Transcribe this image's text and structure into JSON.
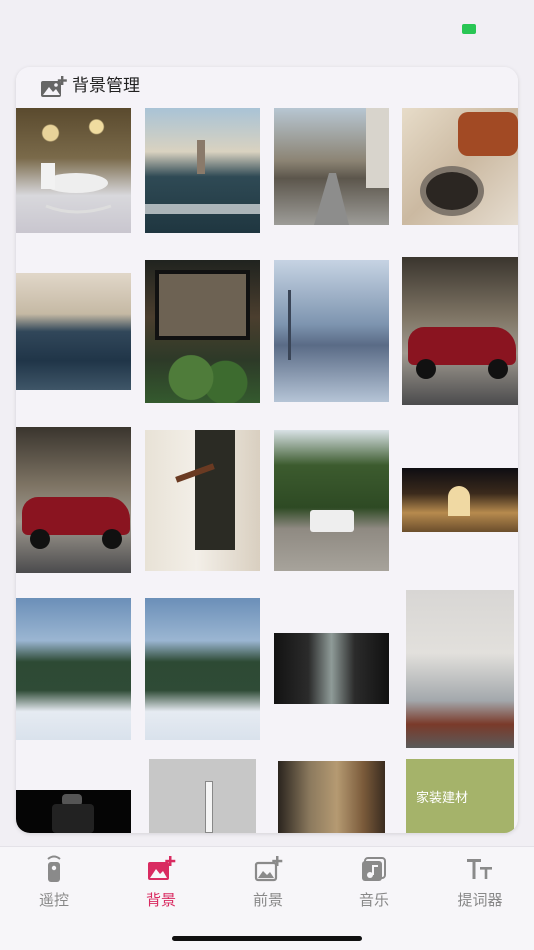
{
  "colors": {
    "accent": "#d92b61",
    "inactive": "#8a8a8a",
    "battery": "#29c654",
    "background": "#f1eff4"
  },
  "header": {
    "icon": "image-plus-icon",
    "title": "背景管理"
  },
  "gallery": {
    "images": [
      {
        "name": "rocking-horse-photo",
        "caption": ""
      },
      {
        "name": "lighthouse-sea-photo",
        "caption": ""
      },
      {
        "name": "tree-lined-street-photo",
        "caption": ""
      },
      {
        "name": "food-bowl-photo",
        "caption": ""
      },
      {
        "name": "city-waterfront-photo",
        "caption": ""
      },
      {
        "name": "cafe-window-plants-photo",
        "caption": ""
      },
      {
        "name": "snowy-road-photo",
        "caption": ""
      },
      {
        "name": "red-sportscar-photo",
        "caption": ""
      },
      {
        "name": "red-sportscar-photo-2",
        "caption": ""
      },
      {
        "name": "boots-stairs-photo",
        "caption": ""
      },
      {
        "name": "white-jeep-forest-photo",
        "caption": ""
      },
      {
        "name": "night-gate-photo",
        "caption": ""
      },
      {
        "name": "snowy-pines-photo",
        "caption": ""
      },
      {
        "name": "snowy-pines-photo-2",
        "caption": ""
      },
      {
        "name": "glass-door-photo",
        "caption": ""
      },
      {
        "name": "office-room-photo",
        "caption": ""
      },
      {
        "name": "webcam-device-photo",
        "caption": ""
      },
      {
        "name": "grey-device-photo",
        "caption": ""
      },
      {
        "name": "autumn-window-photo",
        "caption": ""
      },
      {
        "name": "home-materials-poster",
        "caption": "家装建材"
      }
    ]
  },
  "tabs": [
    {
      "id": "remote",
      "label": "遥控",
      "icon": "remote-icon",
      "active": false
    },
    {
      "id": "background",
      "label": "背景",
      "icon": "image-plus-icon",
      "active": true
    },
    {
      "id": "foreground",
      "label": "前景",
      "icon": "image-plus-outline-icon",
      "active": false
    },
    {
      "id": "music",
      "label": "音乐",
      "icon": "music-note-icon",
      "active": false
    },
    {
      "id": "teleprompter",
      "label": "提词器",
      "icon": "text-size-icon",
      "active": false
    }
  ]
}
